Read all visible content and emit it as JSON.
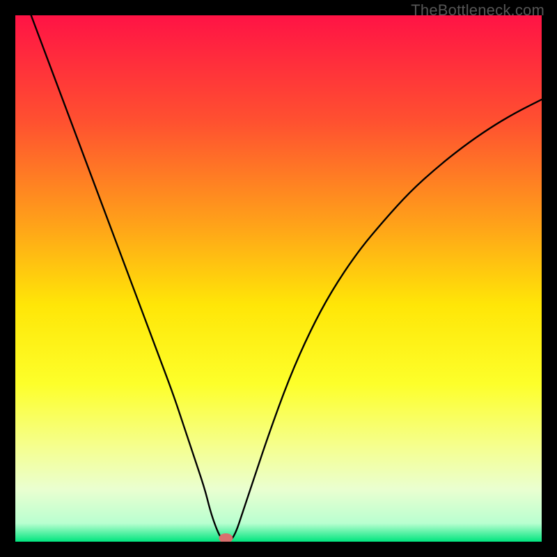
{
  "watermark": "TheBottleneck.com",
  "chart_data": {
    "type": "line",
    "title": "",
    "xlabel": "",
    "ylabel": "",
    "xlim": [
      0,
      100
    ],
    "ylim": [
      0,
      100
    ],
    "gradient_stops": [
      {
        "offset": 0.0,
        "color": "#ff1345"
      },
      {
        "offset": 0.2,
        "color": "#ff5030"
      },
      {
        "offset": 0.4,
        "color": "#ffa319"
      },
      {
        "offset": 0.55,
        "color": "#ffe607"
      },
      {
        "offset": 0.7,
        "color": "#fdff2a"
      },
      {
        "offset": 0.82,
        "color": "#f5ff8f"
      },
      {
        "offset": 0.9,
        "color": "#eaffd0"
      },
      {
        "offset": 0.965,
        "color": "#b9ffd0"
      },
      {
        "offset": 1.0,
        "color": "#00e57e"
      }
    ],
    "ideal_marker": {
      "x": 40,
      "y": 0,
      "color": "#d96f6e"
    },
    "series": [
      {
        "name": "bottleneck-curve",
        "color": "#000000",
        "x": [
          3,
          6,
          9,
          12,
          15,
          18,
          21,
          24,
          27,
          30,
          32,
          34,
          36,
          37,
          38,
          39,
          40,
          41,
          42,
          43,
          45,
          48,
          52,
          56,
          60,
          65,
          70,
          75,
          80,
          85,
          90,
          95,
          100
        ],
        "values": [
          100,
          92,
          84,
          76,
          68,
          60,
          52,
          44,
          36,
          28,
          22,
          16,
          10,
          6,
          3,
          0.7,
          0,
          0.2,
          2,
          5,
          11,
          20,
          31,
          40,
          47.5,
          55,
          61,
          66.5,
          71,
          75,
          78.5,
          81.5,
          84
        ]
      }
    ]
  }
}
